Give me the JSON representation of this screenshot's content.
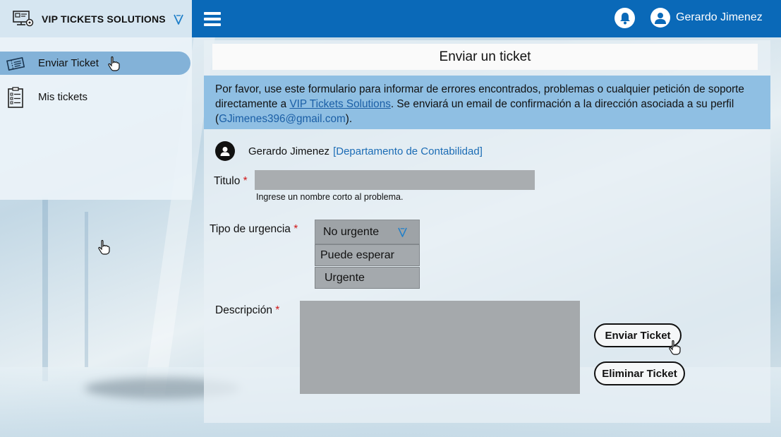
{
  "brand": {
    "title": "VIP TICKETS SOLUTIONS"
  },
  "header": {
    "username": "Gerardo Jimenez"
  },
  "sidebar": {
    "items": [
      {
        "label": "Enviar Ticket",
        "active": true,
        "icon": "ticket-icon"
      },
      {
        "label": "Mis tickets",
        "active": false,
        "icon": "checklist-icon"
      }
    ]
  },
  "main": {
    "title": "Enviar un ticket",
    "info": {
      "text1": "Por favor, use este formulario para informar de errores encontrados, problemas o cualquier petición de soporte  directamente a ",
      "link": "VIP Tickets Solutions",
      "text2": ". Se enviará un email de confirmación a la dirección asociada a su perfil (",
      "email": "GJimenes396@gmail.com",
      "text3": ")."
    },
    "author": {
      "name": "Gerardo Jimenez",
      "department": "[Departamento de Contabilidad]"
    },
    "form": {
      "title_label": "Titulo",
      "title_value": "",
      "title_hint": "Ingrese un nombre corto al problema.",
      "urgency_label": "Tipo de urgencia",
      "urgency_selected": "No urgente",
      "urgency_options": [
        "Puede esperar",
        "Urgente"
      ],
      "description_label": "Descripción",
      "description_value": "",
      "required_mark": "*",
      "submit_label": "Enviar Ticket",
      "delete_label": "Eliminar Ticket"
    }
  },
  "colors": {
    "topbar": "#0a69b8",
    "brand_bg": "#d6e6f1",
    "sidebar_active": "#83b2d8",
    "info_bg": "#8fbfe3",
    "link": "#1b5fa6",
    "required": "#d01818"
  }
}
